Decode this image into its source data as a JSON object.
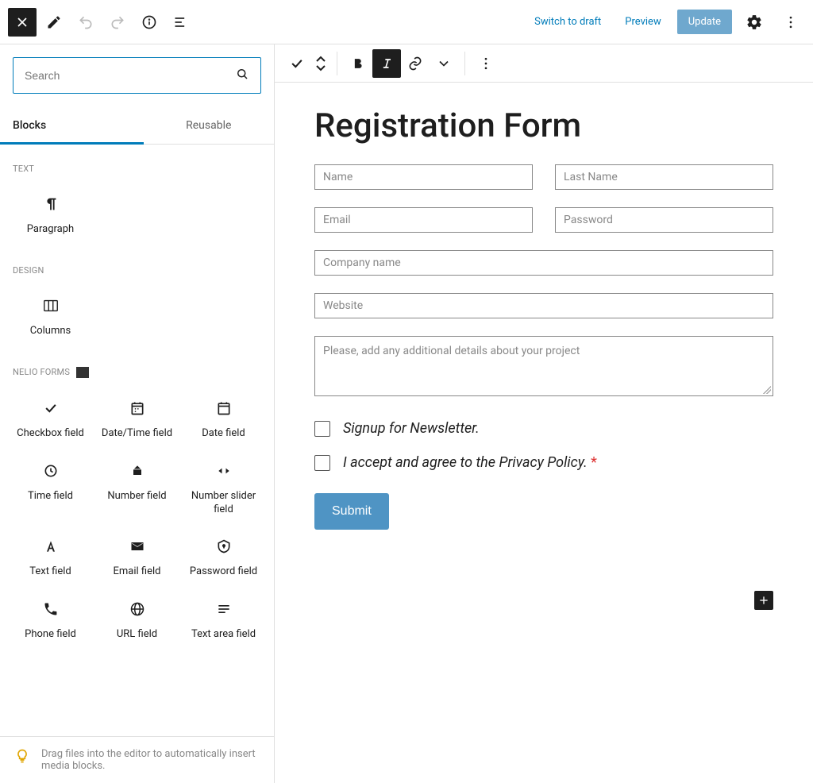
{
  "topbar": {
    "switch_to_draft": "Switch to draft",
    "preview": "Preview",
    "update": "Update"
  },
  "sidebar": {
    "search_placeholder": "Search",
    "tabs": {
      "blocks": "Blocks",
      "reusable": "Reusable"
    },
    "sections": {
      "text": {
        "title": "TEXT",
        "items": [
          {
            "label": "Paragraph"
          }
        ]
      },
      "design": {
        "title": "DESIGN",
        "items": [
          {
            "label": "Columns"
          }
        ]
      },
      "forms": {
        "title": "NELIO FORMS",
        "items": [
          {
            "label": "Checkbox field"
          },
          {
            "label": "Date/Time field"
          },
          {
            "label": "Date field"
          },
          {
            "label": "Time field"
          },
          {
            "label": "Number field"
          },
          {
            "label": "Number slider field"
          },
          {
            "label": "Text field"
          },
          {
            "label": "Email field"
          },
          {
            "label": "Password field"
          },
          {
            "label": "Phone field"
          },
          {
            "label": "URL field"
          },
          {
            "label": "Text area field"
          }
        ]
      }
    },
    "hint": "Drag files into the editor to automatically insert media blocks."
  },
  "editor": {
    "title": "Registration Form",
    "fields": {
      "name": "Name",
      "last_name": "Last Name",
      "email": "Email",
      "password": "Password",
      "company": "Company name",
      "website": "Website",
      "details": "Please, add any additional details about your project"
    },
    "checkboxes": {
      "newsletter": "Signup for Newsletter.",
      "privacy": "I accept and agree to the Privacy Policy.",
      "required_mark": "*"
    },
    "submit": "Submit"
  }
}
